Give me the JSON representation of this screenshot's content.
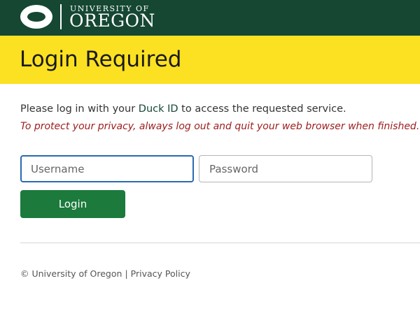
{
  "brand": {
    "university_of": "UNIVERSITY OF",
    "oregon": "OREGON",
    "header_color": "#154733",
    "accent_yellow": "#fce122"
  },
  "page": {
    "title": "Login Required",
    "intro_before": "Please log in with your ",
    "duck_id_link": "Duck ID",
    "intro_after": " to access the requested service.",
    "privacy_notice": "To protect your privacy, always log out and quit your web browser when finished."
  },
  "form": {
    "username_placeholder": "Username",
    "username_value": "",
    "password_placeholder": "Password",
    "password_value": "",
    "login_label": "Login",
    "login_color": "#1b7a3c"
  },
  "footer": {
    "copyright": "© University of Oregon",
    "separator": "|",
    "privacy_policy": "Privacy Policy"
  }
}
